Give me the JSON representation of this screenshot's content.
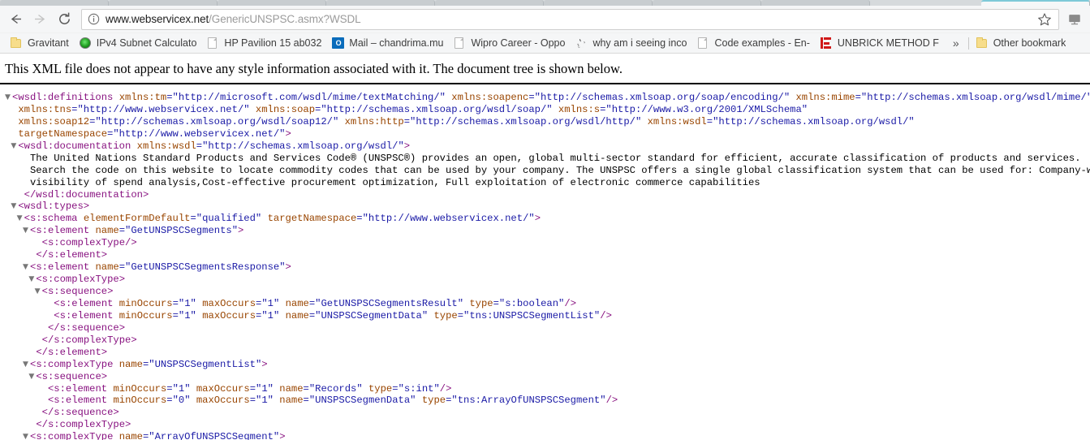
{
  "browser": {
    "nav": {
      "back_label": "Back",
      "forward_label": "Forward",
      "reload_label": "Reload"
    },
    "omnibox": {
      "info_icon": "info-circle-icon",
      "url_domain": "www.webservicex.net",
      "url_path": "/GenericUNSPSC.asmx?WSDL",
      "star_icon": "bookmark-star-icon"
    },
    "cast_icon": "cast-icon",
    "tabs": [
      {
        "label": "",
        "active": false
      },
      {
        "label": "",
        "active": false
      },
      {
        "label": "",
        "active": false
      },
      {
        "label": "",
        "active": false
      },
      {
        "label": "",
        "active": false
      },
      {
        "label": "",
        "active": false
      },
      {
        "label": "",
        "active": false
      },
      {
        "label": "",
        "active": false
      },
      {
        "label": "",
        "active": true
      }
    ],
    "bookmarks": [
      {
        "label": "Gravitant",
        "icon": "folder-icon"
      },
      {
        "label": "IPv4 Subnet Calculato",
        "icon": "globe-icon"
      },
      {
        "label": "HP Pavilion 15 ab032",
        "icon": "page-icon"
      },
      {
        "label": "Mail – chandrima.mu",
        "icon": "outlook-icon"
      },
      {
        "label": "Wipro Career - Oppo",
        "icon": "page-icon"
      },
      {
        "label": "why am i seeing inco",
        "icon": "java-icon"
      },
      {
        "label": "Code examples - En-",
        "icon": "page-icon"
      },
      {
        "label": "UNBRICK METHOD F",
        "icon": "unbrick-icon"
      }
    ],
    "bookmarks_overflow_label": "»",
    "other_bookmarks": {
      "label": "Other bookmark",
      "icon": "folder-icon"
    }
  },
  "page": {
    "notice": "This XML file does not appear to have any style information associated with it. The document tree is shown below.",
    "xml_lines": [
      {
        "indent": 0,
        "twisty": "open",
        "parts": [
          {
            "t": "punc",
            "v": "<"
          },
          {
            "t": "tag",
            "v": "wsdl:definitions"
          },
          {
            "t": "val",
            "v": " "
          },
          {
            "t": "attr",
            "v": "xmlns:tm"
          },
          {
            "t": "val",
            "v": "=\"http://microsoft.com/wsdl/mime/textMatching/\" "
          },
          {
            "t": "attr",
            "v": "xmlns:soapenc"
          },
          {
            "t": "val",
            "v": "=\"http://schemas.xmlsoap.org/soap/encoding/\" "
          },
          {
            "t": "attr",
            "v": "xmlns:mime"
          },
          {
            "t": "val",
            "v": "=\"http://schemas.xmlsoap.org/wsdl/mime/\""
          }
        ]
      },
      {
        "indent": 1,
        "twisty": "none",
        "parts": [
          {
            "t": "attr",
            "v": "xmlns:tns"
          },
          {
            "t": "val",
            "v": "=\"http://www.webservicex.net/\" "
          },
          {
            "t": "attr",
            "v": "xmlns:soap"
          },
          {
            "t": "val",
            "v": "=\"http://schemas.xmlsoap.org/wsdl/soap/\" "
          },
          {
            "t": "attr",
            "v": "xmlns:s"
          },
          {
            "t": "val",
            "v": "=\"http://www.w3.org/2001/XMLSchema\""
          }
        ]
      },
      {
        "indent": 1,
        "twisty": "none",
        "parts": [
          {
            "t": "attr",
            "v": "xmlns:soap12"
          },
          {
            "t": "val",
            "v": "=\"http://schemas.xmlsoap.org/wsdl/soap12/\" "
          },
          {
            "t": "attr",
            "v": "xmlns:http"
          },
          {
            "t": "val",
            "v": "=\"http://schemas.xmlsoap.org/wsdl/http/\" "
          },
          {
            "t": "attr",
            "v": "xmlns:wsdl"
          },
          {
            "t": "val",
            "v": "=\"http://schemas.xmlsoap.org/wsdl/\""
          }
        ]
      },
      {
        "indent": 1,
        "twisty": "none",
        "parts": [
          {
            "t": "attr",
            "v": "targetNamespace"
          },
          {
            "t": "val",
            "v": "=\"http://www.webservicex.net/\""
          },
          {
            "t": "punc",
            "v": ">"
          }
        ]
      },
      {
        "indent": 1,
        "twisty": "open",
        "parts": [
          {
            "t": "punc",
            "v": "<"
          },
          {
            "t": "tag",
            "v": "wsdl:documentation"
          },
          {
            "t": "val",
            "v": " "
          },
          {
            "t": "attr",
            "v": "xmlns:wsdl"
          },
          {
            "t": "val",
            "v": "=\"http://schemas.xmlsoap.org/wsdl/\""
          },
          {
            "t": "punc",
            "v": ">"
          }
        ]
      },
      {
        "indent": 3,
        "twisty": "none",
        "parts": [
          {
            "t": "txt",
            "v": "The United Nations Standard Products and Services Code® (UNSPSC®) provides an open, global multi-sector standard for efficient, accurate classification of products and services."
          }
        ]
      },
      {
        "indent": 3,
        "twisty": "none",
        "parts": [
          {
            "t": "txt",
            "v": "Search the code on this website to locate commodity codes that can be used by your company. The UNSPSC offers a single global classification system that can be used for: Company-wide"
          }
        ]
      },
      {
        "indent": 3,
        "twisty": "none",
        "parts": [
          {
            "t": "txt",
            "v": "visibility of spend analysis,Cost-effective procurement optimization, Full exploitation of electronic commerce capabilities"
          }
        ]
      },
      {
        "indent": 2,
        "twisty": "none",
        "parts": [
          {
            "t": "punc",
            "v": "</"
          },
          {
            "t": "tag",
            "v": "wsdl:documentation"
          },
          {
            "t": "punc",
            "v": ">"
          }
        ]
      },
      {
        "indent": 1,
        "twisty": "open",
        "parts": [
          {
            "t": "punc",
            "v": "<"
          },
          {
            "t": "tag",
            "v": "wsdl:types"
          },
          {
            "t": "punc",
            "v": ">"
          }
        ]
      },
      {
        "indent": 2,
        "twisty": "open",
        "parts": [
          {
            "t": "punc",
            "v": "<"
          },
          {
            "t": "tag",
            "v": "s:schema"
          },
          {
            "t": "val",
            "v": " "
          },
          {
            "t": "attr",
            "v": "elementFormDefault"
          },
          {
            "t": "val",
            "v": "=\"qualified\" "
          },
          {
            "t": "attr",
            "v": "targetNamespace"
          },
          {
            "t": "val",
            "v": "=\"http://www.webservicex.net/\""
          },
          {
            "t": "punc",
            "v": ">"
          }
        ]
      },
      {
        "indent": 3,
        "twisty": "open",
        "parts": [
          {
            "t": "punc",
            "v": "<"
          },
          {
            "t": "tag",
            "v": "s:element"
          },
          {
            "t": "val",
            "v": " "
          },
          {
            "t": "attr",
            "v": "name"
          },
          {
            "t": "val",
            "v": "=\"GetUNSPSCSegments\""
          },
          {
            "t": "punc",
            "v": ">"
          }
        ]
      },
      {
        "indent": 5,
        "twisty": "none",
        "parts": [
          {
            "t": "punc",
            "v": "<"
          },
          {
            "t": "tag",
            "v": "s:complexType"
          },
          {
            "t": "punc",
            "v": "/>"
          }
        ]
      },
      {
        "indent": 4,
        "twisty": "none",
        "parts": [
          {
            "t": "punc",
            "v": "</"
          },
          {
            "t": "tag",
            "v": "s:element"
          },
          {
            "t": "punc",
            "v": ">"
          }
        ]
      },
      {
        "indent": 3,
        "twisty": "open",
        "parts": [
          {
            "t": "punc",
            "v": "<"
          },
          {
            "t": "tag",
            "v": "s:element"
          },
          {
            "t": "val",
            "v": " "
          },
          {
            "t": "attr",
            "v": "name"
          },
          {
            "t": "val",
            "v": "=\"GetUNSPSCSegmentsResponse\""
          },
          {
            "t": "punc",
            "v": ">"
          }
        ]
      },
      {
        "indent": 4,
        "twisty": "open",
        "parts": [
          {
            "t": "punc",
            "v": "<"
          },
          {
            "t": "tag",
            "v": "s:complexType"
          },
          {
            "t": "punc",
            "v": ">"
          }
        ]
      },
      {
        "indent": 5,
        "twisty": "open",
        "parts": [
          {
            "t": "punc",
            "v": "<"
          },
          {
            "t": "tag",
            "v": "s:sequence"
          },
          {
            "t": "punc",
            "v": ">"
          }
        ]
      },
      {
        "indent": 7,
        "twisty": "none",
        "parts": [
          {
            "t": "punc",
            "v": "<"
          },
          {
            "t": "tag",
            "v": "s:element"
          },
          {
            "t": "val",
            "v": " "
          },
          {
            "t": "attr",
            "v": "minOccurs"
          },
          {
            "t": "val",
            "v": "=\"1\" "
          },
          {
            "t": "attr",
            "v": "maxOccurs"
          },
          {
            "t": "val",
            "v": "=\"1\" "
          },
          {
            "t": "attr",
            "v": "name"
          },
          {
            "t": "val",
            "v": "=\"GetUNSPSCSegmentsResult\" "
          },
          {
            "t": "attr",
            "v": "type"
          },
          {
            "t": "val",
            "v": "=\"s:boolean\""
          },
          {
            "t": "punc",
            "v": "/>"
          }
        ]
      },
      {
        "indent": 7,
        "twisty": "none",
        "parts": [
          {
            "t": "punc",
            "v": "<"
          },
          {
            "t": "tag",
            "v": "s:element"
          },
          {
            "t": "val",
            "v": " "
          },
          {
            "t": "attr",
            "v": "minOccurs"
          },
          {
            "t": "val",
            "v": "=\"1\" "
          },
          {
            "t": "attr",
            "v": "maxOccurs"
          },
          {
            "t": "val",
            "v": "=\"1\" "
          },
          {
            "t": "attr",
            "v": "name"
          },
          {
            "t": "val",
            "v": "=\"UNSPSCSegmentData\" "
          },
          {
            "t": "attr",
            "v": "type"
          },
          {
            "t": "val",
            "v": "=\"tns:UNSPSCSegmentList\""
          },
          {
            "t": "punc",
            "v": "/>"
          }
        ]
      },
      {
        "indent": 6,
        "twisty": "none",
        "parts": [
          {
            "t": "punc",
            "v": "</"
          },
          {
            "t": "tag",
            "v": "s:sequence"
          },
          {
            "t": "punc",
            "v": ">"
          }
        ]
      },
      {
        "indent": 5,
        "twisty": "none",
        "parts": [
          {
            "t": "punc",
            "v": "</"
          },
          {
            "t": "tag",
            "v": "s:complexType"
          },
          {
            "t": "punc",
            "v": ">"
          }
        ]
      },
      {
        "indent": 4,
        "twisty": "none",
        "parts": [
          {
            "t": "punc",
            "v": "</"
          },
          {
            "t": "tag",
            "v": "s:element"
          },
          {
            "t": "punc",
            "v": ">"
          }
        ]
      },
      {
        "indent": 3,
        "twisty": "open",
        "parts": [
          {
            "t": "punc",
            "v": "<"
          },
          {
            "t": "tag",
            "v": "s:complexType"
          },
          {
            "t": "val",
            "v": " "
          },
          {
            "t": "attr",
            "v": "name"
          },
          {
            "t": "val",
            "v": "=\"UNSPSCSegmentList\""
          },
          {
            "t": "punc",
            "v": ">"
          }
        ]
      },
      {
        "indent": 4,
        "twisty": "open",
        "parts": [
          {
            "t": "punc",
            "v": "<"
          },
          {
            "t": "tag",
            "v": "s:sequence"
          },
          {
            "t": "punc",
            "v": ">"
          }
        ]
      },
      {
        "indent": 6,
        "twisty": "none",
        "parts": [
          {
            "t": "punc",
            "v": "<"
          },
          {
            "t": "tag",
            "v": "s:element"
          },
          {
            "t": "val",
            "v": " "
          },
          {
            "t": "attr",
            "v": "minOccurs"
          },
          {
            "t": "val",
            "v": "=\"1\" "
          },
          {
            "t": "attr",
            "v": "maxOccurs"
          },
          {
            "t": "val",
            "v": "=\"1\" "
          },
          {
            "t": "attr",
            "v": "name"
          },
          {
            "t": "val",
            "v": "=\"Records\" "
          },
          {
            "t": "attr",
            "v": "type"
          },
          {
            "t": "val",
            "v": "=\"s:int\""
          },
          {
            "t": "punc",
            "v": "/>"
          }
        ]
      },
      {
        "indent": 6,
        "twisty": "none",
        "parts": [
          {
            "t": "punc",
            "v": "<"
          },
          {
            "t": "tag",
            "v": "s:element"
          },
          {
            "t": "val",
            "v": " "
          },
          {
            "t": "attr",
            "v": "minOccurs"
          },
          {
            "t": "val",
            "v": "=\"0\" "
          },
          {
            "t": "attr",
            "v": "maxOccurs"
          },
          {
            "t": "val",
            "v": "=\"1\" "
          },
          {
            "t": "attr",
            "v": "name"
          },
          {
            "t": "val",
            "v": "=\"UNSPSCSegmenData\" "
          },
          {
            "t": "attr",
            "v": "type"
          },
          {
            "t": "val",
            "v": "=\"tns:ArrayOfUNSPSCSegment\""
          },
          {
            "t": "punc",
            "v": "/>"
          }
        ]
      },
      {
        "indent": 5,
        "twisty": "none",
        "parts": [
          {
            "t": "punc",
            "v": "</"
          },
          {
            "t": "tag",
            "v": "s:sequence"
          },
          {
            "t": "punc",
            "v": ">"
          }
        ]
      },
      {
        "indent": 4,
        "twisty": "none",
        "parts": [
          {
            "t": "punc",
            "v": "</"
          },
          {
            "t": "tag",
            "v": "s:complexType"
          },
          {
            "t": "punc",
            "v": ">"
          }
        ]
      },
      {
        "indent": 3,
        "twisty": "open",
        "parts": [
          {
            "t": "punc",
            "v": "<"
          },
          {
            "t": "tag",
            "v": "s:complexType"
          },
          {
            "t": "val",
            "v": " "
          },
          {
            "t": "attr",
            "v": "name"
          },
          {
            "t": "val",
            "v": "=\"ArrayOfUNSPSCSegment\""
          },
          {
            "t": "punc",
            "v": ">"
          }
        ]
      }
    ]
  }
}
